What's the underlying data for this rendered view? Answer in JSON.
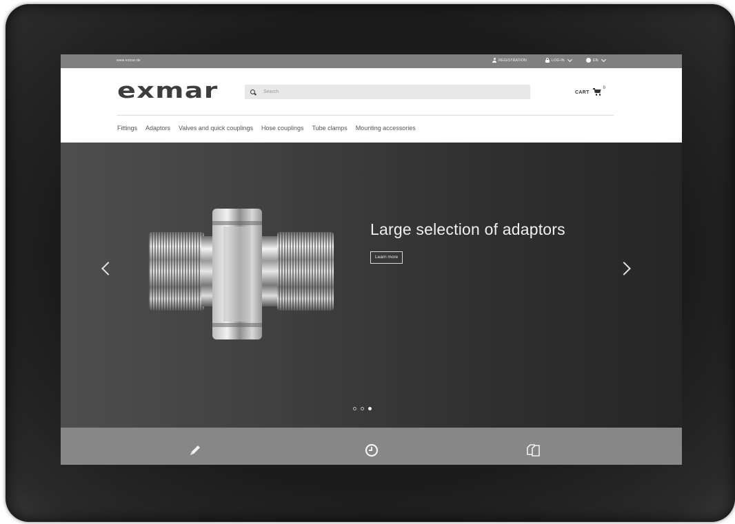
{
  "topbar": {
    "site_url": "www.exmar.de",
    "registration_label": "REGISTRATION",
    "login_label": "LOG IN",
    "language_label": "EN"
  },
  "header": {
    "logo_text": "exmar",
    "search_placeholder": "Search",
    "cart_label": "CART",
    "cart_count": "0"
  },
  "nav": {
    "items": [
      {
        "label": "Fittings"
      },
      {
        "label": "Adaptors"
      },
      {
        "label": "Valves and quick couplings"
      },
      {
        "label": "Hose couplings"
      },
      {
        "label": "Tube clamps"
      },
      {
        "label": "Mounting accessories"
      }
    ]
  },
  "hero": {
    "headline": "Large selection of adaptors",
    "cta_label": "Learn more",
    "slide_count": 3,
    "active_slide": 3
  },
  "features": {
    "icons": [
      "pencil-icon",
      "clock-icon",
      "documents-icon"
    ]
  },
  "colors": {
    "topbar_bg": "#808080",
    "hero_bg": "#3a3a3a",
    "feature_bar_bg": "#878787",
    "logo": "#3d3d3d"
  }
}
